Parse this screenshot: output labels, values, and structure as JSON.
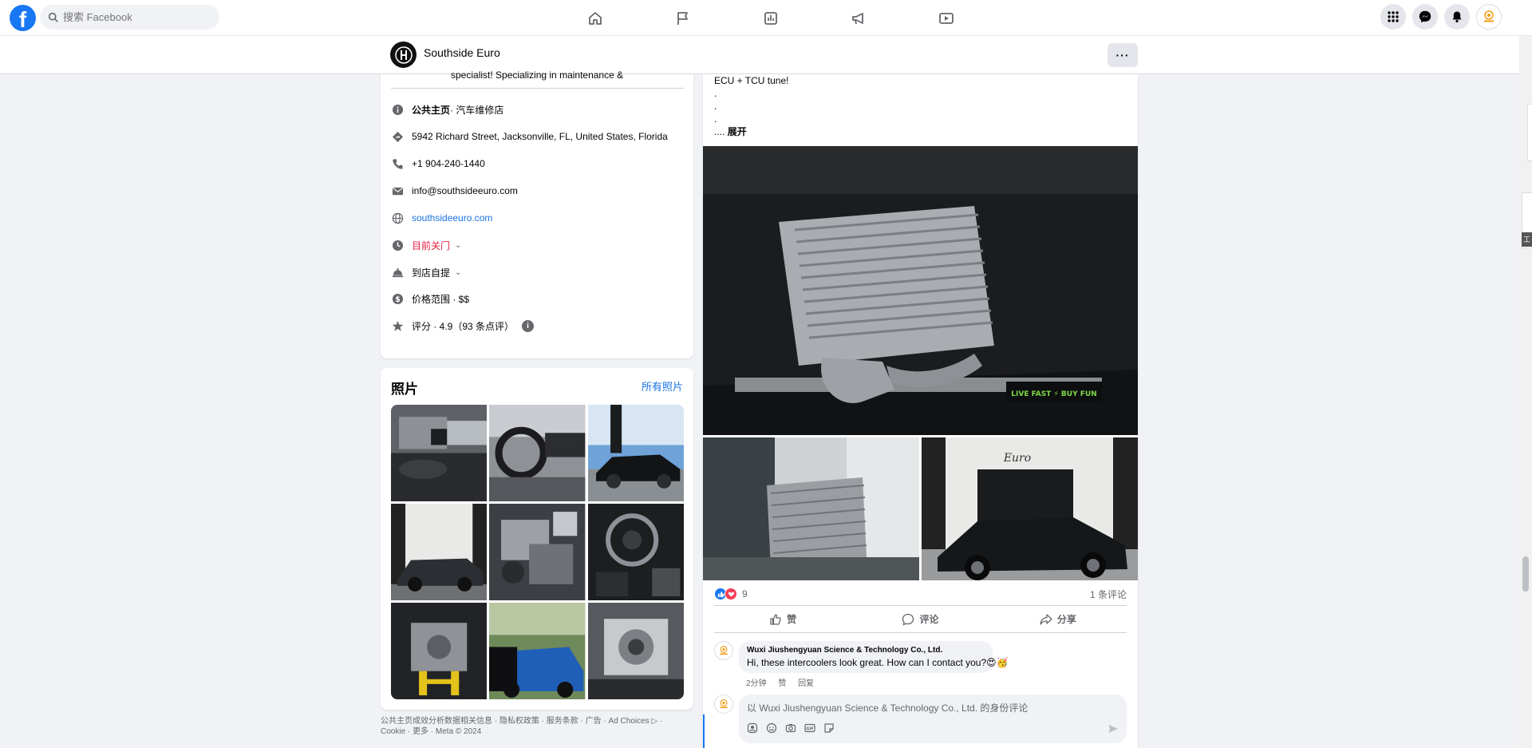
{
  "topbar": {
    "search_placeholder": "搜索 Facebook",
    "nav": [
      "home-icon",
      "flag-icon",
      "chart-icon",
      "megaphone-icon",
      "video-icon"
    ],
    "right": [
      "apps-icon",
      "messenger-icon",
      "notifications-icon",
      "account-avatar"
    ]
  },
  "page_header": {
    "name": "Southside Euro",
    "more": "···"
  },
  "intro": {
    "cut_text": "specialist! Specializing in maintenance &",
    "category_label": "公共主页",
    "category_value": " · 汽车维修店",
    "address": "5942 Richard Street, Jacksonville, FL, United States, Florida",
    "phone": "+1 904-240-1440",
    "email": "info@southsideeuro.com",
    "website": "southsideeuro.com",
    "hours": "目前关门",
    "pickup": "到店自提",
    "price": "价格范围 · $$",
    "rating": "评分 · 4.9（93 条点评）"
  },
  "photos": {
    "title": "照片",
    "all_link": "所有照片"
  },
  "footer": {
    "line1": "公共主页成效分析数据相关信息 · 隐私权政策 · 服务条款 · 广告 · Ad Choices ▷ ·",
    "line2": "Cookie · 更多 · Meta © 2024"
  },
  "post": {
    "text_line": "ECU + TCU tune!",
    "dots": [
      ".",
      ".",
      "."
    ],
    "ellipsis": "....",
    "see_more": "展开",
    "reaction_count": "9",
    "comment_count": "1 条评论",
    "actions": {
      "like": "赞",
      "comment": "评论",
      "share": "分享"
    }
  },
  "comment": {
    "author": "Wuxi Jiushengyuan Science & Technology Co., Ltd.",
    "text": "Hi, these intercoolers look great. How can I contact you?😍🥳",
    "time": "2分钟",
    "like": "赞",
    "reply": "回复"
  },
  "composer": {
    "placeholder": "以 Wuxi Jiushengyuan Science & Technology Co., Ltd. 的身份评论"
  },
  "side_tab": {
    "label": "工"
  },
  "colors": {
    "brand": "#1877f2",
    "closed": "#e41e3f",
    "link": "#1b74e4"
  }
}
